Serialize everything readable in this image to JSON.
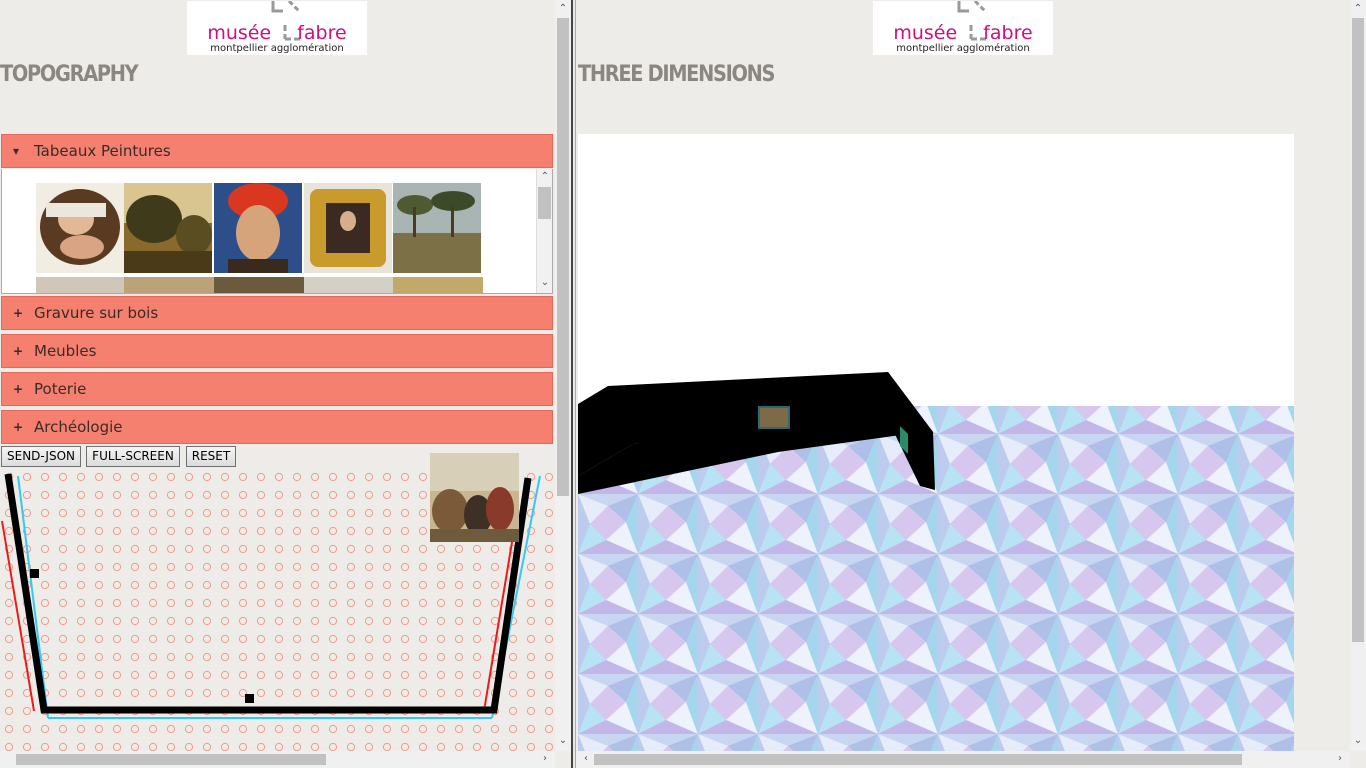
{
  "logo": {
    "word1": "musée",
    "word2": "fabre",
    "subtitle": "montpellier agglomération"
  },
  "left_panel": {
    "title": "TOPOGRAPHY"
  },
  "right_panel": {
    "title": "THREE DIMENSIONS"
  },
  "accordion": [
    {
      "label": "Tabeaux Peintures",
      "sign": "▾",
      "expanded": true
    },
    {
      "label": "Gravure sur bois",
      "sign": "+",
      "expanded": false
    },
    {
      "label": "Meubles",
      "sign": "+",
      "expanded": false
    },
    {
      "label": "Poterie",
      "sign": "+",
      "expanded": false
    },
    {
      "label": "Archéologie",
      "sign": "+",
      "expanded": false
    }
  ],
  "toolbar": {
    "send_json": "SEND-JSON",
    "full_screen": "FULL-SCREEN",
    "reset": "RESET"
  },
  "colors": {
    "accent": "#f6806f",
    "logo_pink": "#c8127f",
    "grid_dot": "#f29a8c",
    "wall": "#000000",
    "guide_blue": "#35c8f0",
    "guide_red": "#e81c1c"
  }
}
